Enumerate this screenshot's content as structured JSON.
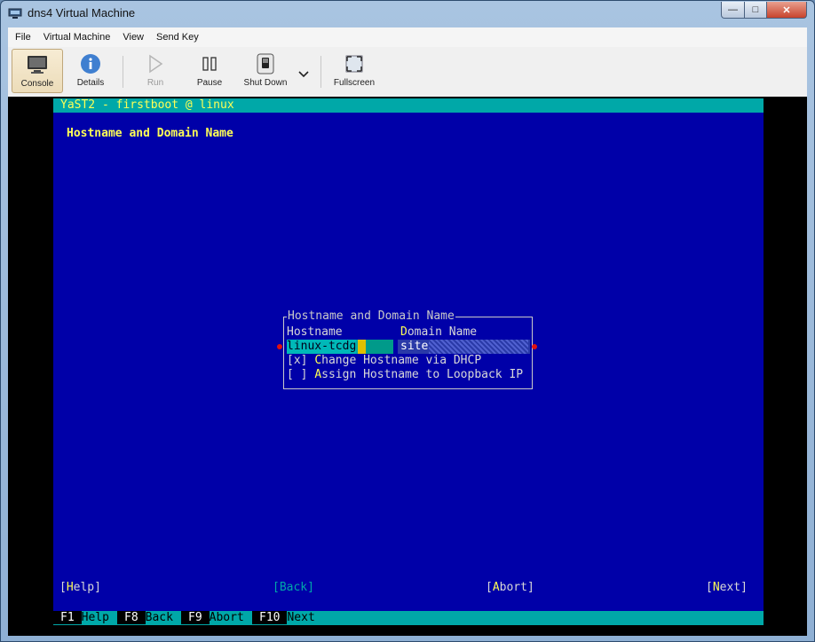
{
  "window": {
    "title": "dns4 Virtual Machine",
    "minimize_glyph": "—",
    "maximize_glyph": "□",
    "close_glyph": "✕"
  },
  "menu": [
    "File",
    "Virtual Machine",
    "View",
    "Send Key"
  ],
  "toolbar": {
    "console": "Console",
    "details": "Details",
    "run": "Run",
    "pause": "Pause",
    "shutdown": "Shut Down",
    "fullscreen": "Fullscreen"
  },
  "tui": {
    "top_title": "YaST2 - firstboot @ linux",
    "header": "Hostname and Domain Name",
    "dialog_title": "Hostname and Domain Name",
    "hostname_label_hot": "Ho",
    "hostname_label_rest": "stname",
    "domain_label_hot": "D",
    "domain_label_rest": "omain Name",
    "hostname_value": "linux-tcdg",
    "domain_value": "site",
    "dhcp_checkbox": "[x]",
    "dhcp_label_hot": "C",
    "dhcp_label_rest": "hange Hostname via DHCP",
    "loopback_checkbox": "[ ]",
    "loopback_label_hot": "A",
    "loopback_label_rest": "ssign Hostname to Loopback IP",
    "btn_help_open": "[",
    "btn_help_hot": "H",
    "btn_help_rest": "elp]",
    "btn_back": "[Back]",
    "btn_abort_open": "[",
    "btn_abort_hot": "A",
    "btn_abort_rest": "bort]",
    "btn_next_open": "[",
    "btn_next_hot": "N",
    "btn_next_rest": "ext]",
    "fkeys": [
      {
        "key": "F1",
        "label": "Help"
      },
      {
        "key": "F8",
        "label": "Back"
      },
      {
        "key": "F9",
        "label": "Abort"
      },
      {
        "key": "F10",
        "label": "Next"
      }
    ]
  }
}
